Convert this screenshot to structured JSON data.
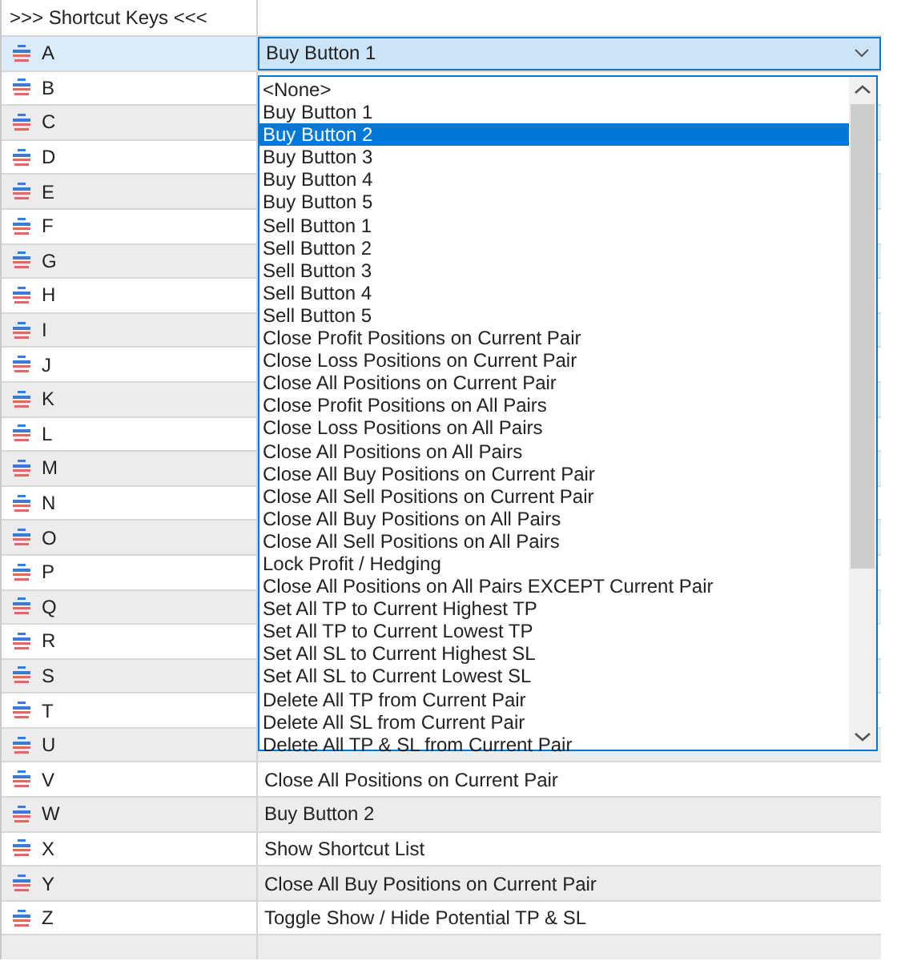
{
  "header": {
    "title": ">>> Shortcut Keys <<<"
  },
  "rows": [
    {
      "key": "A",
      "selected": true,
      "action": "Buy Button 1"
    },
    {
      "key": "B",
      "selected": false
    },
    {
      "key": "C",
      "selected": false
    },
    {
      "key": "D",
      "selected": false
    },
    {
      "key": "E",
      "selected": false
    },
    {
      "key": "F",
      "selected": false
    },
    {
      "key": "G",
      "selected": false
    },
    {
      "key": "H",
      "selected": false
    },
    {
      "key": "I",
      "selected": false
    },
    {
      "key": "J",
      "selected": false
    },
    {
      "key": "K",
      "selected": false
    },
    {
      "key": "L",
      "selected": false
    },
    {
      "key": "M",
      "selected": false
    },
    {
      "key": "N",
      "selected": false
    },
    {
      "key": "O",
      "selected": false
    },
    {
      "key": "P",
      "selected": false
    },
    {
      "key": "Q",
      "selected": false
    },
    {
      "key": "R",
      "selected": false
    },
    {
      "key": "S",
      "selected": false
    },
    {
      "key": "T",
      "selected": false
    },
    {
      "key": "U",
      "selected": false
    },
    {
      "key": "V",
      "selected": false,
      "action": "Close All Positions on Current Pair"
    },
    {
      "key": "W",
      "selected": false,
      "action": "Buy Button 2"
    },
    {
      "key": "X",
      "selected": false,
      "action": "Show Shortcut List"
    },
    {
      "key": "Y",
      "selected": false,
      "action": "Close All Buy Positions on Current Pair"
    },
    {
      "key": "Z",
      "selected": false,
      "action": "Toggle Show / Hide Potential TP & SL"
    }
  ],
  "dropdown": {
    "options": [
      {
        "label": "<None>",
        "selected": false
      },
      {
        "label": "Buy Button 1",
        "selected": false
      },
      {
        "label": "Buy Button 2",
        "selected": true
      },
      {
        "label": "Buy Button 3",
        "selected": false
      },
      {
        "label": "Buy Button 4",
        "selected": false
      },
      {
        "label": "Buy Button 5",
        "selected": false
      },
      {
        "label": "Sell Button 1",
        "selected": false
      },
      {
        "label": "Sell Button 2",
        "selected": false
      },
      {
        "label": "Sell Button 3",
        "selected": false
      },
      {
        "label": "Sell Button 4",
        "selected": false
      },
      {
        "label": "Sell Button 5",
        "selected": false
      },
      {
        "label": "Close Profit Positions on Current Pair",
        "selected": false
      },
      {
        "label": "Close Loss Positions on Current Pair",
        "selected": false
      },
      {
        "label": "Close All Positions on Current Pair",
        "selected": false
      },
      {
        "label": "Close Profit Positions on All Pairs",
        "selected": false
      },
      {
        "label": "Close Loss Positions on All Pairs",
        "selected": false
      },
      {
        "label": "Close All Positions on All Pairs",
        "selected": false
      },
      {
        "label": "Close All Buy Positions on Current Pair",
        "selected": false
      },
      {
        "label": "Close All Sell Positions on Current Pair",
        "selected": false
      },
      {
        "label": "Close All Buy Positions on All Pairs",
        "selected": false
      },
      {
        "label": "Close All Sell Positions on All Pairs",
        "selected": false
      },
      {
        "label": "Lock Profit / Hedging",
        "selected": false
      },
      {
        "label": "Close All Positions on All Pairs EXCEPT Current Pair",
        "selected": false
      },
      {
        "label": "Set All TP to Current Highest TP",
        "selected": false
      },
      {
        "label": "Set All TP to Current Lowest TP",
        "selected": false
      },
      {
        "label": "Set All SL to Current Highest SL",
        "selected": false
      },
      {
        "label": "Set All SL to Current Lowest SL",
        "selected": false
      },
      {
        "label": "Delete All TP from Current Pair",
        "selected": false
      },
      {
        "label": "Delete All SL from Current Pair",
        "selected": false
      },
      {
        "label": "Delete All TP & SL from Current Pair",
        "selected": false
      }
    ]
  }
}
